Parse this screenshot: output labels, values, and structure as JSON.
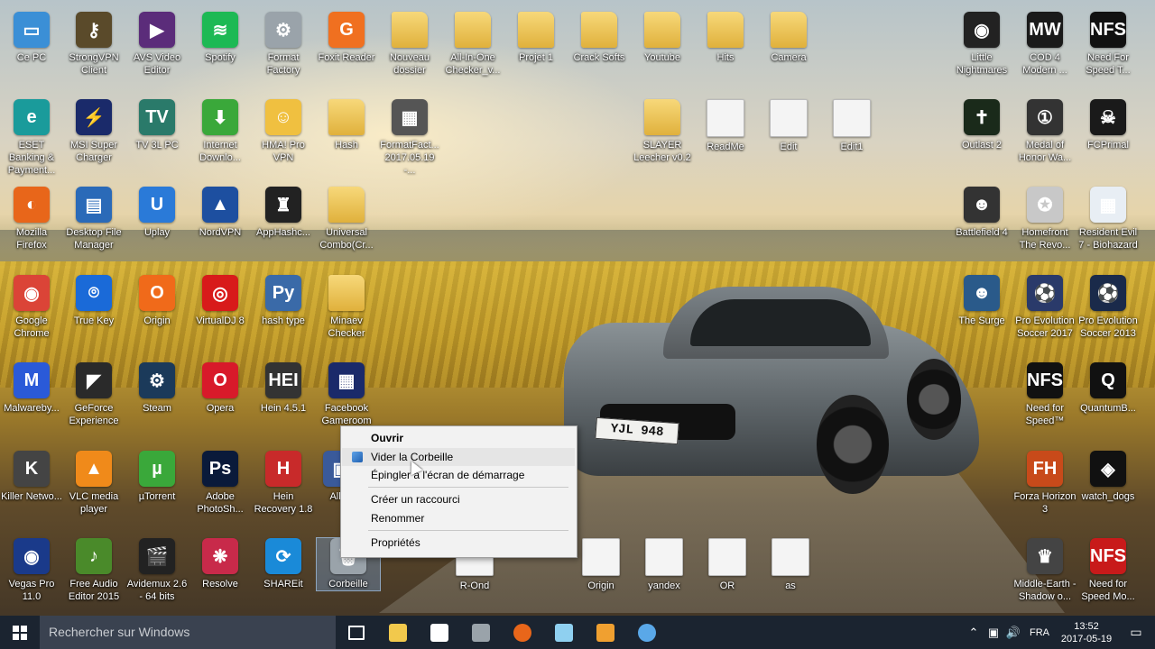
{
  "desktop": {
    "icons": [
      {
        "label": "Ce PC",
        "color": "#3b8fd6",
        "glyph": "▭"
      },
      {
        "label": "StrongVPN Client",
        "color": "#5a4a2a",
        "glyph": "⚷"
      },
      {
        "label": "AVS Video Editor",
        "color": "#5b2c7a",
        "glyph": "▶"
      },
      {
        "label": "Spotify",
        "color": "#1db954",
        "glyph": "≋"
      },
      {
        "label": "Format Factory",
        "color": "#9aa3aa",
        "glyph": "⚙"
      },
      {
        "label": "Foxit Reader",
        "color": "#f07020",
        "glyph": "G"
      },
      {
        "label": "Nouveau dossier",
        "color": "",
        "glyph": ""
      },
      {
        "label": "All-In-One Checker_v...",
        "color": "",
        "glyph": ""
      },
      {
        "label": "Projet 1",
        "color": "",
        "glyph": ""
      },
      {
        "label": "Crack Softs",
        "color": "",
        "glyph": ""
      },
      {
        "label": "Youtube",
        "color": "",
        "glyph": ""
      },
      {
        "label": "Hits",
        "color": "",
        "glyph": ""
      },
      {
        "label": "Camera",
        "color": "",
        "glyph": ""
      },
      {
        "label": "ESET Banking & Payment...",
        "color": "#1a9b9b",
        "glyph": "e"
      },
      {
        "label": "MSI Super Charger",
        "color": "#1a2a6a",
        "glyph": "⚡"
      },
      {
        "label": "TV 3L PC",
        "color": "#2a7a6a",
        "glyph": "TV"
      },
      {
        "label": "Internet Downlo...",
        "color": "#3aa83a",
        "glyph": "⬇"
      },
      {
        "label": "HMA! Pro VPN",
        "color": "#f0c040",
        "glyph": "☺"
      },
      {
        "label": "Hash",
        "color": "",
        "glyph": ""
      },
      {
        "label": "FormatFact... 2017.05.19 -...",
        "color": "#555",
        "glyph": "▦"
      },
      {
        "label": "SLAYER Leecher v0.2",
        "color": "",
        "glyph": ""
      },
      {
        "label": "ReadMe",
        "color": "",
        "glyph": ""
      },
      {
        "label": "Edit",
        "color": "",
        "glyph": ""
      },
      {
        "label": "Edit1",
        "color": "",
        "glyph": ""
      },
      {
        "label": "Mozilla Firefox",
        "color": "#e8661a",
        "glyph": "◐"
      },
      {
        "label": "Desktop File Manager",
        "color": "#2a6ab8",
        "glyph": "▤"
      },
      {
        "label": "Uplay",
        "color": "#2a7ad8",
        "glyph": "U"
      },
      {
        "label": "NordVPN",
        "color": "#1d4fa0",
        "glyph": "▲"
      },
      {
        "label": "AppHashc...",
        "color": "#222",
        "glyph": "♜"
      },
      {
        "label": "Universal Combo(Cr...",
        "color": "",
        "glyph": ""
      },
      {
        "label": "Google Chrome",
        "color": "#db4437",
        "glyph": "◉"
      },
      {
        "label": "True Key",
        "color": "#1a6ad8",
        "glyph": "⌾"
      },
      {
        "label": "Origin",
        "color": "#f06a1a",
        "glyph": "O"
      },
      {
        "label": "VirtualDJ 8",
        "color": "#d81a1a",
        "glyph": "◎"
      },
      {
        "label": "hash type",
        "color": "#3a6aa8",
        "glyph": "Py"
      },
      {
        "label": "Minaev Checker",
        "color": "",
        "glyph": ""
      },
      {
        "label": "Malwareby...",
        "color": "#2a5ad8",
        "glyph": "M"
      },
      {
        "label": "GeForce Experience",
        "color": "#2a2a2a",
        "glyph": "◤"
      },
      {
        "label": "Steam",
        "color": "#1b3a5a",
        "glyph": "⚙"
      },
      {
        "label": "Opera",
        "color": "#d81a2a",
        "glyph": "O"
      },
      {
        "label": "Hein 4.5.1",
        "color": "#333",
        "glyph": "HEI"
      },
      {
        "label": "Facebook Gameroom",
        "color": "#1a2a6a",
        "glyph": "▦"
      },
      {
        "label": "Killer Netwo...",
        "color": "#444",
        "glyph": "K"
      },
      {
        "label": "VLC media player",
        "color": "#f08a1a",
        "glyph": "▲"
      },
      {
        "label": "µTorrent",
        "color": "#3aa83a",
        "glyph": "µ"
      },
      {
        "label": "Adobe PhotoSh...",
        "color": "#0a1a3a",
        "glyph": "Ps"
      },
      {
        "label": "Hein Recovery 1.8",
        "color": "#c82a2a",
        "glyph": "H"
      },
      {
        "label": "All-...",
        "color": "#3a5a9a",
        "glyph": "▣"
      },
      {
        "label": "Vegas Pro 11.0",
        "color": "#1a3a8a",
        "glyph": "◉"
      },
      {
        "label": "Free Audio Editor 2015",
        "color": "#4a8a2a",
        "glyph": "♪"
      },
      {
        "label": "Avidemux 2.6 - 64 bits",
        "color": "#222",
        "glyph": "🎬"
      },
      {
        "label": "Resolve",
        "color": "#c82a4a",
        "glyph": "❋"
      },
      {
        "label": "SHAREit",
        "color": "#1a8ad8",
        "glyph": "⟳"
      },
      {
        "label": "Corbeille",
        "color": "#9aa3aa",
        "glyph": "🗑"
      },
      {
        "label": "R-Ond",
        "color": "",
        "glyph": ""
      },
      {
        "label": "Origin",
        "color": "",
        "glyph": ""
      },
      {
        "label": "yandex",
        "color": "",
        "glyph": ""
      },
      {
        "label": "OR",
        "color": "",
        "glyph": ""
      },
      {
        "label": "as",
        "color": "",
        "glyph": ""
      },
      {
        "label": "Little Nightmares",
        "color": "#222",
        "glyph": "◉"
      },
      {
        "label": "COD 4 Modern ...",
        "color": "#1a1a1a",
        "glyph": "MW"
      },
      {
        "label": "Need For Speed T...",
        "color": "#111",
        "glyph": "NFS"
      },
      {
        "label": "Outlast 2",
        "color": "#1a2a1a",
        "glyph": "✝"
      },
      {
        "label": "Medal of Honor Wa...",
        "color": "#333",
        "glyph": "①"
      },
      {
        "label": "FCPrimal",
        "color": "#1a1a1a",
        "glyph": "☠"
      },
      {
        "label": "Battlefield 4",
        "color": "#333",
        "glyph": "☻"
      },
      {
        "label": "Homefront The Revo...",
        "color": "#c8c8c8",
        "glyph": "✪"
      },
      {
        "label": "Resident Evil 7 - Biohazard",
        "color": "#e8eef4",
        "glyph": "▦"
      },
      {
        "label": "The Surge",
        "color": "#2a5a8a",
        "glyph": "☻"
      },
      {
        "label": "Pro Evolution Soccer 2017",
        "color": "#2a3a6a",
        "glyph": "⚽"
      },
      {
        "label": "Pro Evolution Soccer 2013",
        "color": "#1a2a4a",
        "glyph": "⚽"
      },
      {
        "label": "Need for Speed™",
        "color": "#111",
        "glyph": "NFS"
      },
      {
        "label": "QuantumB...",
        "color": "#111",
        "glyph": "Q"
      },
      {
        "label": "Forza Horizon 3",
        "color": "#c84a1a",
        "glyph": "FH"
      },
      {
        "label": "watch_dogs",
        "color": "#111",
        "glyph": "◈"
      },
      {
        "label": "Middle-Earth - Shadow o...",
        "color": "#444",
        "glyph": "♛"
      },
      {
        "label": "Need for Speed Mo...",
        "color": "#c81a1a",
        "glyph": "NFS"
      }
    ]
  },
  "context_menu": {
    "items": [
      "Ouvrir",
      "Vider la Corbeille",
      "Épingler à l'écran de démarrage",
      "Créer un raccourci",
      "Renommer",
      "Propriétés"
    ]
  },
  "taskbar": {
    "search_placeholder": "Rechercher sur Windows",
    "language": "FRA",
    "time": "13:52",
    "date": "2017-05-19"
  },
  "colors": {
    "taskbar": "#1b2430",
    "search": "#3a4250",
    "menu_bg": "#f2f2f2"
  }
}
